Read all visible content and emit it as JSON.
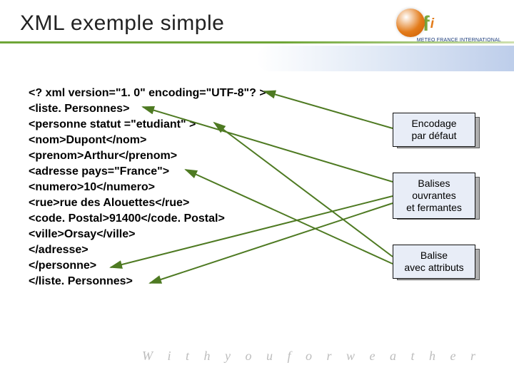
{
  "title": "XML exemple simple",
  "logo": {
    "m": "m",
    "f": "f",
    "i": "i",
    "sub": "METEO FRANCE INTERNATIONAL"
  },
  "code": {
    "l0": "<? xml version=\"1. 0\" encoding=\"UTF-8\"? >",
    "l1": "<liste. Personnes>",
    "l2": "<personne statut =\"etudiant\" >",
    "l3": "<nom>Dupont</nom>",
    "l4": "<prenom>Arthur</prenom>",
    "l5": "<adresse pays=\"France\">",
    "l6": "<numero>10</numero>",
    "l7": "<rue>rue des Alouettes</rue>",
    "l8": "<code. Postal>91400</code. Postal>",
    "l9": "<ville>Orsay</ville>",
    "l10": "</adresse>",
    "l11": "</personne>",
    "l12": "</liste. Personnes>"
  },
  "callouts": {
    "c1": {
      "line1": "Encodage",
      "line2": "par défaut"
    },
    "c2": {
      "line1": "Balises",
      "line2": "ouvrantes",
      "line3": "et fermantes"
    },
    "c3": {
      "line1": "Balise",
      "line2": "avec attributs"
    }
  },
  "tagline": "W i t h   y o u   f o r   w e a t h e r",
  "colors": {
    "green": "#6fa637",
    "darkgreen": "#4e7a22"
  }
}
